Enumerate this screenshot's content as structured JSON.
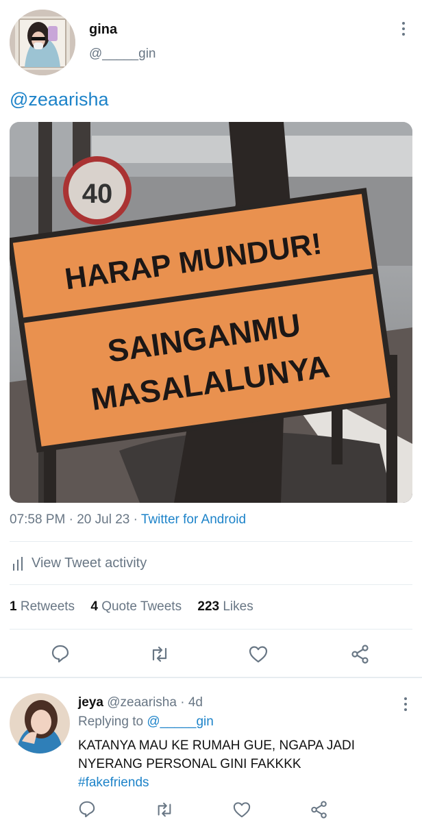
{
  "tweet": {
    "author_name": "gina",
    "author_handle": "@_____gin",
    "text_mention": "@zeaarisha",
    "image": {
      "sign_line1": "HARAP MUNDUR!",
      "sign_line2a": "SAINGANMU",
      "sign_line2b": "MASALALUNYA",
      "speed_sign": "40"
    },
    "time": "07:58 PM",
    "date": "20 Jul 23",
    "source": "Twitter for Android",
    "sep": "·",
    "activity_label": "View Tweet activity",
    "stats": {
      "retweets_count": "1",
      "retweets_label": "Retweets",
      "quotes_count": "4",
      "quotes_label": "Quote Tweets",
      "likes_count": "223",
      "likes_label": "Likes"
    },
    "actions": [
      "reply-icon",
      "retweet-icon",
      "like-icon",
      "share-icon"
    ]
  },
  "reply": {
    "author_name": "jeya",
    "author_handle": "@zeaarisha",
    "age": "· 4d",
    "replying_label": "Replying to",
    "replying_to": "@_____gin",
    "text_line1": "KATANYA MAU KE RUMAH GUE, NGAPA JADI",
    "text_line2": "NYERANG PERSONAL GINI FAKKKK",
    "hashtag": "#fakefriends",
    "actions": [
      "reply-icon",
      "retweet-icon",
      "like-icon",
      "share-icon"
    ]
  },
  "colors": {
    "link_blue": "#1d83c9",
    "secondary_gray": "#687684",
    "sign_orange": "#e9914f",
    "divider": "#e6ecf0"
  }
}
